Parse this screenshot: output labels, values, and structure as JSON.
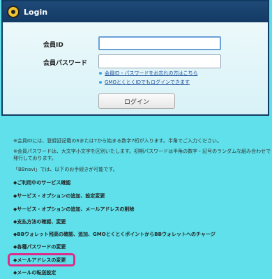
{
  "login": {
    "title": "Login",
    "member_id_label": "会員ID",
    "member_id_value": "",
    "password_label": "会員パスワード",
    "password_value": "",
    "links": [
      "会員ID・パスワードをお忘れの方はこちら",
      "GMOとくとくIDでもログインできます"
    ],
    "submit_label": "ログイン"
  },
  "info": {
    "notes": [
      "※会員IDには、登録証記載の6または7から始まる数字7桁が入ります。半角でご入力ください。",
      "※会員パスワードは、大文字小文字を区別いたします。初期パスワードは半角の数字・記号のランダムな組み合わせで発行しております。",
      "「BBnavi」では、以下のお手続きが可能です。"
    ],
    "items": [
      "◆ご利用中のサービス確認",
      "◆サービス・オプションの追加、設定変更",
      "◆サービス・オプションの追加、メールアドレスの削除",
      "◆支払方法の確認、変更",
      "◆BBウォレット残高の確認、追加、GMOとくとくポイントからBBウォレットへのチャージ",
      "◆各種パスワードの変更",
      "◆メールアドレスの変更",
      "◆メールの転送設定"
    ]
  },
  "colors": {
    "background": "#5fe0ea",
    "header": "#123a63",
    "highlight": "#e02a8a",
    "link": "#1d4f9a"
  }
}
